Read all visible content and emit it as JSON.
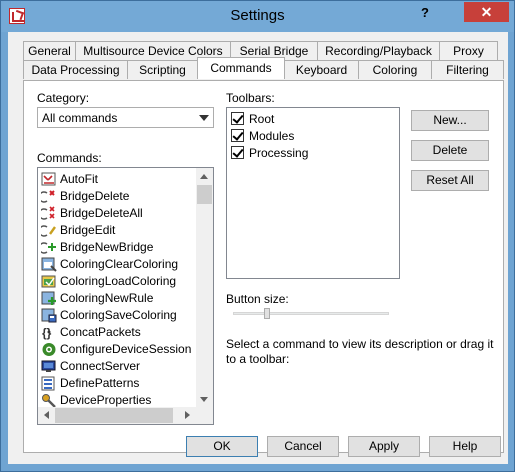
{
  "window": {
    "title": "Settings",
    "help_caption": "?",
    "close_caption": "✕"
  },
  "tabs_row1": [
    {
      "label": "General"
    },
    {
      "label": "Multisource Device Colors"
    },
    {
      "label": "Serial Bridge"
    },
    {
      "label": "Recording/Playback"
    },
    {
      "label": "Proxy"
    }
  ],
  "tabs_row2": [
    {
      "label": "Data Processing"
    },
    {
      "label": "Scripting"
    },
    {
      "label": "Commands",
      "active": true
    },
    {
      "label": "Keyboard"
    },
    {
      "label": "Coloring"
    },
    {
      "label": "Filtering"
    }
  ],
  "category": {
    "label": "Category:",
    "selected": "All commands"
  },
  "commands": {
    "label": "Commands:",
    "items": [
      {
        "label": "AutoFit",
        "icon": "autofit-icon"
      },
      {
        "label": "BridgeDelete",
        "icon": "bridge-delete-icon"
      },
      {
        "label": "BridgeDeleteAll",
        "icon": "bridge-delete-all-icon"
      },
      {
        "label": "BridgeEdit",
        "icon": "bridge-edit-icon"
      },
      {
        "label": "BridgeNewBridge",
        "icon": "bridge-new-icon"
      },
      {
        "label": "ColoringClearColoring",
        "icon": "coloring-clear-icon"
      },
      {
        "label": "ColoringLoadColoring",
        "icon": "coloring-load-icon"
      },
      {
        "label": "ColoringNewRule",
        "icon": "coloring-new-rule-icon"
      },
      {
        "label": "ColoringSaveColoring",
        "icon": "coloring-save-icon"
      },
      {
        "label": "ConcatPackets",
        "icon": "concat-packets-icon"
      },
      {
        "label": "ConfigureDeviceSession",
        "icon": "configure-session-icon"
      },
      {
        "label": "ConnectServer",
        "icon": "connect-server-icon"
      },
      {
        "label": "DefinePatterns",
        "icon": "define-patterns-icon"
      },
      {
        "label": "DeviceProperties",
        "icon": "device-properties-icon"
      }
    ]
  },
  "toolbars": {
    "label": "Toolbars:",
    "items": [
      {
        "label": "Root",
        "checked": true
      },
      {
        "label": "Modules",
        "checked": true
      },
      {
        "label": "Processing",
        "checked": true
      }
    ]
  },
  "side_buttons": {
    "new": "New...",
    "delete": "Delete",
    "reset_all": "Reset All"
  },
  "button_size": {
    "label": "Button size:"
  },
  "description": "Select a command to view its description or drag it to a toolbar:",
  "footer": {
    "ok": "OK",
    "cancel": "Cancel",
    "apply": "Apply",
    "help": "Help"
  },
  "colors": {
    "title_bar": "#74a9d6",
    "close_button": "#c7403a",
    "dialog_bg": "#f0f0f0"
  }
}
